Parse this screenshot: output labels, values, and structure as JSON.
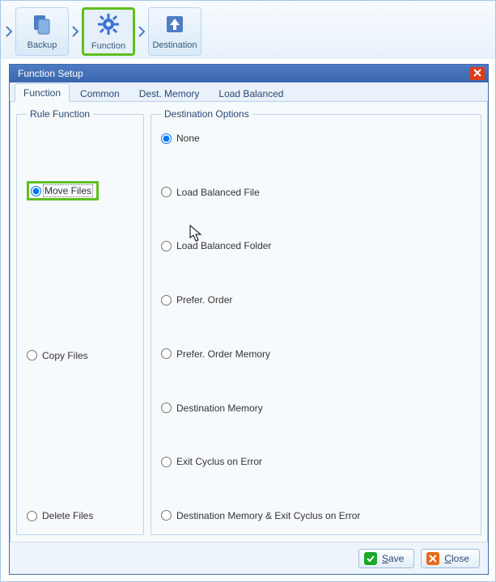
{
  "toolbar": {
    "items": [
      {
        "label": "Backup",
        "icon": "copy"
      },
      {
        "label": "Function",
        "icon": "gear",
        "selected": true
      },
      {
        "label": "Destination",
        "icon": "upload"
      }
    ]
  },
  "dialog": {
    "title": "Function Setup",
    "tabs": [
      "Function",
      "Common",
      "Dest. Memory",
      "Load Balanced"
    ],
    "active_tab": 0,
    "rule_function": {
      "legend": "Rule Function",
      "options": [
        "Move Files",
        "Copy Files",
        "Delete Files"
      ],
      "selected": 0
    },
    "destination_options": {
      "legend": "Destination Options",
      "options": [
        "None",
        "Load Balanced File",
        "Load Balanced Folder",
        "Prefer. Order",
        "Prefer. Order Memory",
        "Destination Memory",
        "Exit Cyclus on Error",
        "Destination Memory & Exit Cyclus on Error"
      ],
      "selected": 0
    },
    "buttons": {
      "save": "Save",
      "close": "Close"
    }
  }
}
